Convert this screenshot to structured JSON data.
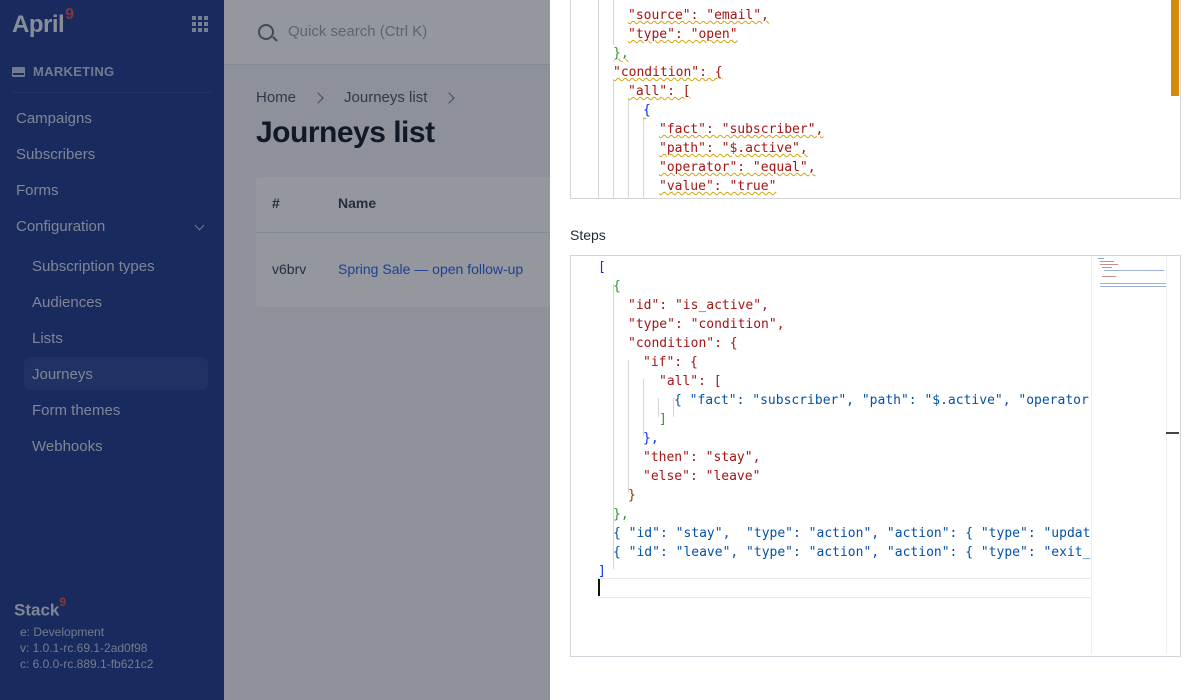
{
  "sidebar": {
    "logo": "April",
    "logo_sup": "9",
    "section": "MARKETING",
    "items": [
      "Campaigns",
      "Subscribers",
      "Forms",
      "Configuration"
    ],
    "config_items": [
      "Subscription types",
      "Audiences",
      "Lists",
      "Journeys",
      "Form themes",
      "Webhooks"
    ],
    "active_item": "Journeys",
    "footer": {
      "brand": "Stack",
      "brand_sup": "9",
      "env": "e: Development",
      "version": "v: 1.0.1-rc.69.1-2ad0f98",
      "core": "c: 6.0.0-rc.889.1-fb621c2"
    }
  },
  "topbar": {
    "search_placeholder": "Quick search (Ctrl K)"
  },
  "breadcrumb": [
    "Home",
    "Journeys list"
  ],
  "page_title": "Journeys list",
  "table": {
    "headers": [
      "#",
      "Name"
    ],
    "rows": [
      {
        "id": "v6brv",
        "name": "Spring Sale — open follow-up"
      }
    ]
  },
  "drawer": {
    "steps_label": "Steps",
    "trigger_lines": [
      "\"source\": \"email\",",
      "\"type\": \"open\"",
      "},",
      "\"condition\": {",
      "\"all\": [",
      "{",
      "\"fact\": \"subscriber\",",
      "\"path\": \"$.active\",",
      "\"operator\": \"equal\",",
      "\"value\": \"true\""
    ],
    "steps_lines": [
      "[",
      "{",
      "\"id\": \"is_active\",",
      "\"type\": \"condition\",",
      "\"condition\": {",
      "\"if\": {",
      "\"all\": [",
      "{ \"fact\": \"subscriber\", \"path\": \"$.active\", \"operator\"",
      "]",
      "},",
      "\"then\": \"stay\",",
      "\"else\": \"leave\"",
      "}",
      "},",
      "{ \"id\": \"stay\",  \"type\": \"action\", \"action\": { \"type\": \"update_",
      "{ \"id\": \"leave\", \"type\": \"action\", \"action\": { \"type\": \"exit_jo",
      "]"
    ]
  }
}
